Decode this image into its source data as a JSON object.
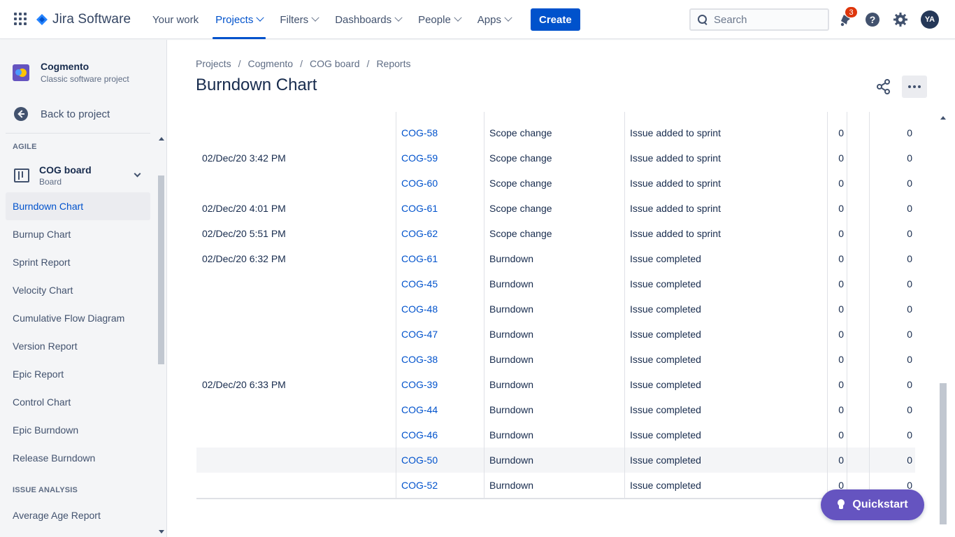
{
  "topnav": {
    "app_name": "Jira Software",
    "items": [
      {
        "label": "Your work",
        "has_chevron": false,
        "active": false
      },
      {
        "label": "Projects",
        "has_chevron": true,
        "active": true
      },
      {
        "label": "Filters",
        "has_chevron": true,
        "active": false
      },
      {
        "label": "Dashboards",
        "has_chevron": true,
        "active": false
      },
      {
        "label": "People",
        "has_chevron": true,
        "active": false
      },
      {
        "label": "Apps",
        "has_chevron": true,
        "active": false
      }
    ],
    "create_label": "Create",
    "search_placeholder": "Search",
    "notifications_count": "3",
    "avatar_initials": "YA"
  },
  "sidebar": {
    "project_name": "Cogmento",
    "project_type": "Classic software project",
    "back_label": "Back to project",
    "section_agile": "AGILE",
    "board_name": "COG board",
    "board_type": "Board",
    "items": [
      {
        "label": "Burndown Chart",
        "active": true
      },
      {
        "label": "Burnup Chart",
        "active": false
      },
      {
        "label": "Sprint Report",
        "active": false
      },
      {
        "label": "Velocity Chart",
        "active": false
      },
      {
        "label": "Cumulative Flow Diagram",
        "active": false
      },
      {
        "label": "Version Report",
        "active": false
      },
      {
        "label": "Epic Report",
        "active": false
      },
      {
        "label": "Control Chart",
        "active": false
      },
      {
        "label": "Epic Burndown",
        "active": false
      },
      {
        "label": "Release Burndown",
        "active": false
      }
    ],
    "section_issue_analysis": "ISSUE ANALYSIS",
    "analysis_items": [
      {
        "label": "Average Age Report"
      }
    ]
  },
  "breadcrumb": [
    "Projects",
    "Cogmento",
    "COG board",
    "Reports"
  ],
  "page_title": "Burndown Chart",
  "table": {
    "rows": [
      {
        "date": "",
        "key": "COG-58",
        "event_type": "Scope change",
        "detail": "Issue added to sprint",
        "value1": "0",
        "value2": "0"
      },
      {
        "date": "02/Dec/20 3:42 PM",
        "key": "COG-59",
        "event_type": "Scope change",
        "detail": "Issue added to sprint",
        "value1": "0",
        "value2": "0"
      },
      {
        "date": "",
        "key": "COG-60",
        "event_type": "Scope change",
        "detail": "Issue added to sprint",
        "value1": "0",
        "value2": "0"
      },
      {
        "date": "02/Dec/20 4:01 PM",
        "key": "COG-61",
        "event_type": "Scope change",
        "detail": "Issue added to sprint",
        "value1": "0",
        "value2": "0"
      },
      {
        "date": "02/Dec/20 5:51 PM",
        "key": "COG-62",
        "event_type": "Scope change",
        "detail": "Issue added to sprint",
        "value1": "0",
        "value2": "0"
      },
      {
        "date": "02/Dec/20 6:32 PM",
        "key": "COG-61",
        "event_type": "Burndown",
        "detail": "Issue completed",
        "value1": "0",
        "value2": "0"
      },
      {
        "date": "",
        "key": "COG-45",
        "event_type": "Burndown",
        "detail": "Issue completed",
        "value1": "0",
        "value2": "0"
      },
      {
        "date": "",
        "key": "COG-48",
        "event_type": "Burndown",
        "detail": "Issue completed",
        "value1": "0",
        "value2": "0"
      },
      {
        "date": "",
        "key": "COG-47",
        "event_type": "Burndown",
        "detail": "Issue completed",
        "value1": "0",
        "value2": "0"
      },
      {
        "date": "",
        "key": "COG-38",
        "event_type": "Burndown",
        "detail": "Issue completed",
        "value1": "0",
        "value2": "0"
      },
      {
        "date": "02/Dec/20 6:33 PM",
        "key": "COG-39",
        "event_type": "Burndown",
        "detail": "Issue completed",
        "value1": "0",
        "value2": "0"
      },
      {
        "date": "",
        "key": "COG-44",
        "event_type": "Burndown",
        "detail": "Issue completed",
        "value1": "0",
        "value2": "0"
      },
      {
        "date": "",
        "key": "COG-46",
        "event_type": "Burndown",
        "detail": "Issue completed",
        "value1": "0",
        "value2": "0"
      },
      {
        "date": "",
        "key": "COG-50",
        "event_type": "Burndown",
        "detail": "Issue completed",
        "value1": "0",
        "value2": "0",
        "highlighted": true
      },
      {
        "date": "",
        "key": "COG-52",
        "event_type": "Burndown",
        "detail": "Issue completed",
        "value1": "0",
        "value2": "0"
      }
    ]
  },
  "quickstart_label": "Quickstart",
  "colors": {
    "brand_blue": "#0052cc",
    "quickstart_purple": "#6554c0",
    "badge_red": "#de350b"
  },
  "icons": [
    "app-switcher-icon",
    "jira-logo-icon",
    "search-icon",
    "notification-bell-icon",
    "help-icon",
    "settings-gear-icon",
    "back-arrow-icon",
    "board-icon",
    "chevron-down-icon",
    "share-icon",
    "more-icon",
    "lightbulb-icon"
  ]
}
